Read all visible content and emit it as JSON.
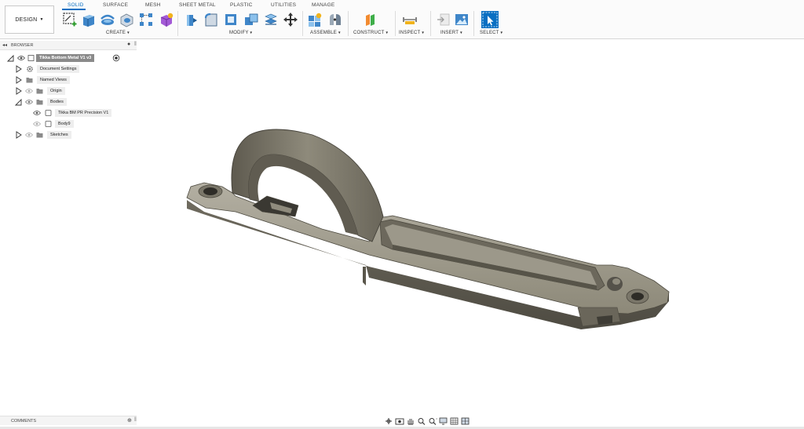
{
  "workspace": {
    "label": "DESIGN"
  },
  "tabs": [
    "SOLID",
    "SURFACE",
    "MESH",
    "SHEET METAL",
    "PLASTIC",
    "UTILITIES",
    "MANAGE"
  ],
  "groups": {
    "create": "CREATE",
    "modify": "MODIFY",
    "assemble": "ASSEMBLE",
    "construct": "CONSTRUCT",
    "inspect": "INSPECT",
    "insert": "INSERT",
    "select": "SELECT"
  },
  "browser": {
    "title": "BROWSER",
    "root": "Tikka Bottom Metal V1 v3",
    "document_settings": "Document Settings",
    "named_views": "Named Views",
    "origin": "Origin",
    "bodies": "Bodies",
    "body1": "Tikka BM PR Precision V1",
    "body2": "Body9",
    "sketches": "Sketches"
  },
  "comments": {
    "title": "COMMENTS"
  },
  "colors": {
    "accent": "#0a6fc2",
    "model_dark": "#5a564b",
    "model_light": "#a9a597"
  },
  "icons": [
    "new-sketch-icon",
    "extrude-icon",
    "revolve-icon",
    "hole-icon",
    "pattern-icon",
    "create-form-icon",
    "press-pull-icon",
    "fillet-icon",
    "shell-icon",
    "combine-icon",
    "align-icon",
    "move-icon",
    "new-component-icon",
    "joint-icon",
    "offset-plane-icon",
    "measure-icon",
    "insert-icon",
    "canvas-icon",
    "select-icon"
  ]
}
